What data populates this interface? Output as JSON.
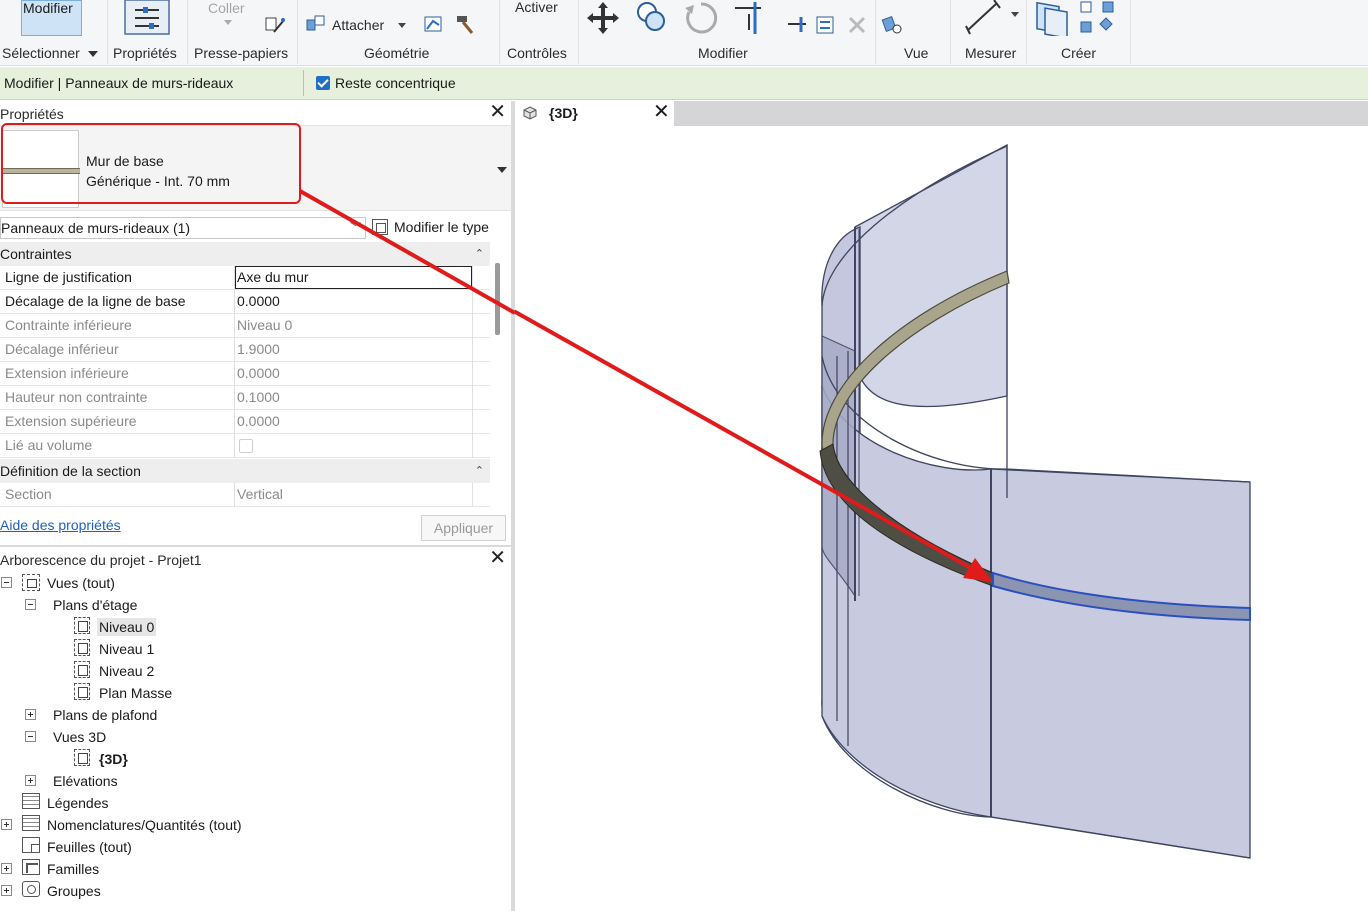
{
  "ribbon": {
    "modify_button": "Modifier",
    "paste_label": "Coller",
    "attach_label": "Attacher",
    "activate_label": "Activer",
    "groups": {
      "select": "Sélectionner",
      "properties": "Propriétés",
      "clipboard": "Presse-papiers",
      "geometry": "Géométrie",
      "controls": "Contrôles",
      "modify": "Modifier",
      "view": "Vue",
      "measure": "Mesurer",
      "create": "Créer"
    }
  },
  "options_bar": {
    "context": "Modifier | Panneaux de murs-rideaux",
    "checkbox_label": "Reste concentrique",
    "checkbox_checked": true
  },
  "properties": {
    "title": "Propriétés",
    "type_family": "Mur de base",
    "type_name": "Générique - Int. 70 mm",
    "filter": "Panneaux de murs-rideaux (1)",
    "edit_type": "Modifier le type",
    "sections": [
      {
        "name": "Contraintes",
        "rows": [
          {
            "key": "Ligne de justification",
            "value": "Axe du mur",
            "enabled": true
          },
          {
            "key": "Décalage de la ligne de base",
            "value": "0.0000",
            "enabled": true
          },
          {
            "key": "Contrainte inférieure",
            "value": "Niveau 0",
            "enabled": false
          },
          {
            "key": "Décalage inférieur",
            "value": "1.9000",
            "enabled": false
          },
          {
            "key": "Extension inférieure",
            "value": "0.0000",
            "enabled": false
          },
          {
            "key": "Hauteur non contrainte",
            "value": "0.1000",
            "enabled": false
          },
          {
            "key": "Extension supérieure",
            "value": "0.0000",
            "enabled": false
          },
          {
            "key": "Lié au volume",
            "value": "",
            "enabled": false
          }
        ]
      },
      {
        "name": "Définition de la section",
        "rows": [
          {
            "key": "Section",
            "value": "Vertical",
            "enabled": false
          }
        ]
      }
    ],
    "help_link": "Aide des propriétés",
    "apply": "Appliquer"
  },
  "browser": {
    "title": "Arborescence du projet - Projet1",
    "items": [
      "Vues (tout)",
      "Plans d'étage",
      "Niveau 0",
      "Niveau 1",
      "Niveau 2",
      "Plan Masse",
      "Plans de plafond",
      "Vues 3D",
      "{3D}",
      "Elévations",
      "Légendes",
      "Nomenclatures/Quantités (tout)",
      "Feuilles (tout)",
      "Familles",
      "Groupes"
    ]
  },
  "view": {
    "tab_label": "{3D}"
  },
  "colors": {
    "annotation_red": "#e01b1b",
    "curtain_panel": "#c9cce0",
    "wall_band": "#a8a58c",
    "selection_blue": "#2a4fbf"
  }
}
